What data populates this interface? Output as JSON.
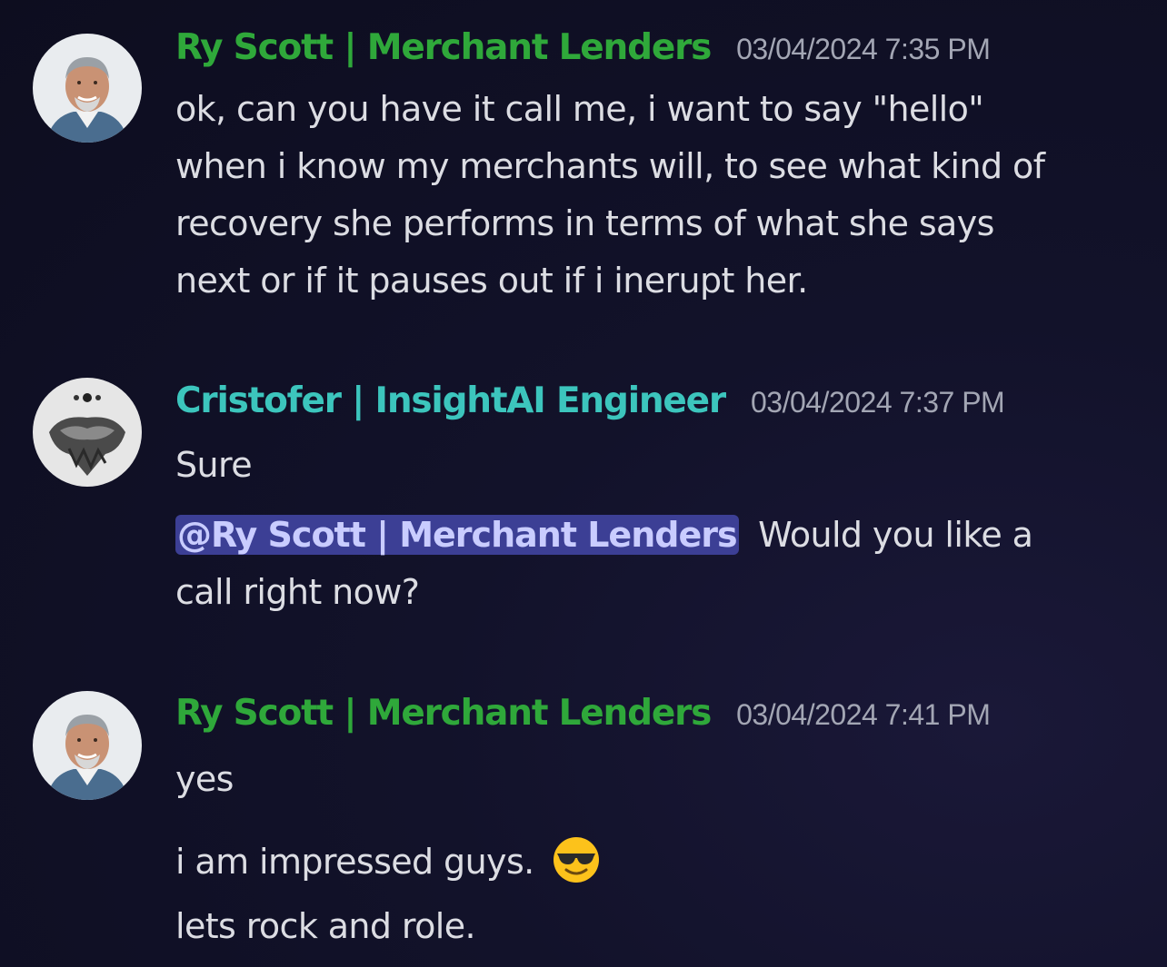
{
  "messages": [
    {
      "author": "Ry Scott | Merchant Lenders",
      "timestamp": "03/04/2024 7:35 PM",
      "lines": [
        "ok, can you have it call me, i want to say \"hello\"",
        "when i know my merchants will, to see what kind of",
        "recovery she performs in terms of what she says",
        "next or if it pauses out if i inerupt her."
      ]
    },
    {
      "author": "Cristofer | InsightAI Engineer",
      "timestamp": "03/04/2024 7:37 PM",
      "lines": [
        "Sure"
      ],
      "mention": "@Ry Scott | Merchant Lenders",
      "mention_text": "Would you like a",
      "mention_text_cont": "call right now?"
    },
    {
      "author": "Ry Scott | Merchant Lenders",
      "timestamp": "03/04/2024 7:41 PM",
      "lines": [
        "yes",
        "i am impressed guys.",
        "lets rock and role."
      ]
    }
  ],
  "colors": {
    "author_ry": "#2fa83a",
    "author_cristofer": "#3cc5bd",
    "mention_bg": "#3c3f95",
    "background": "#0d0d1f"
  },
  "icons": {
    "emoji": "sunglasses-emoji-icon"
  }
}
